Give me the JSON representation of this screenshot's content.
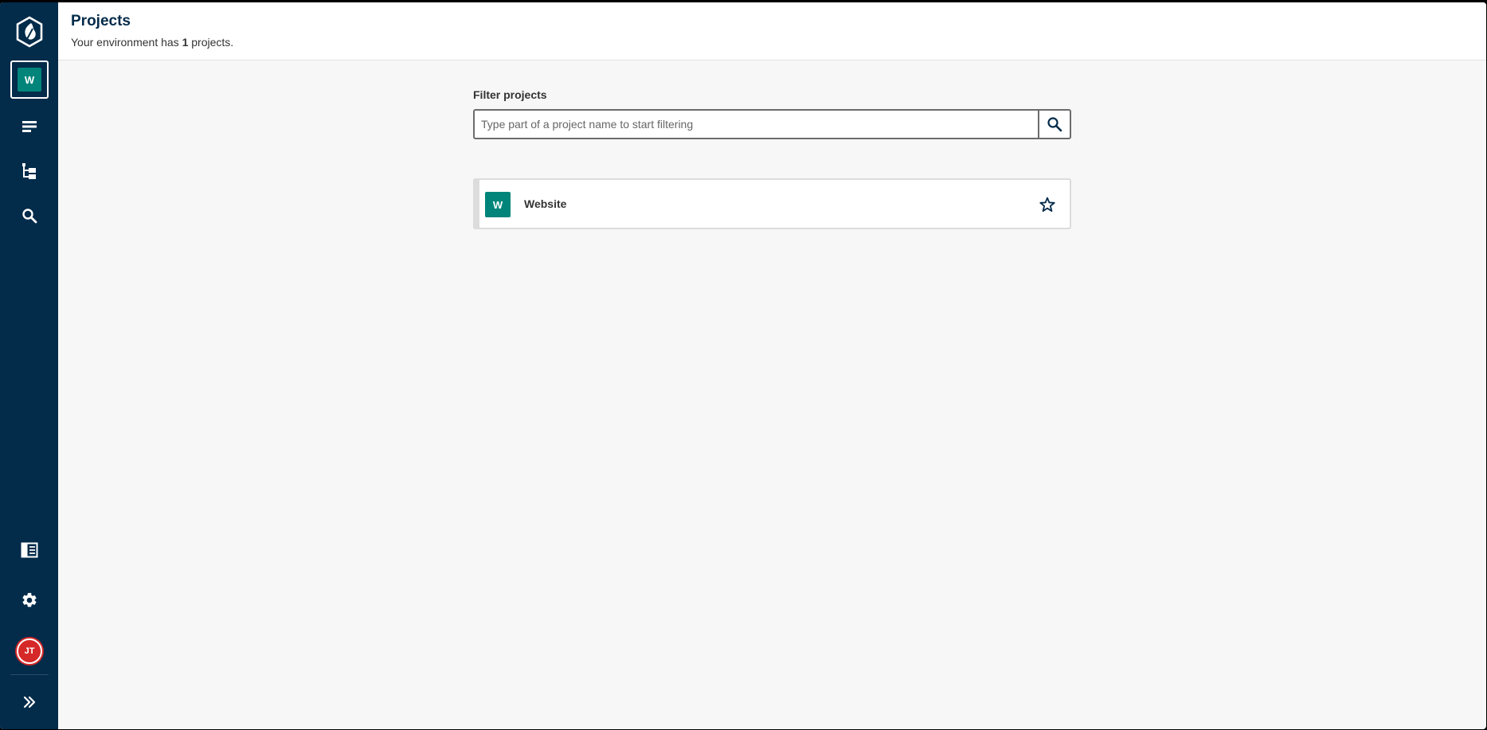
{
  "header": {
    "title": "Projects",
    "subtitle_prefix": "Your environment has ",
    "project_count": "1",
    "subtitle_suffix": " projects."
  },
  "sidebar": {
    "current_project_initial": "W",
    "user_initials": "JT",
    "icons": [
      "logo-icon",
      "list-icon",
      "tree-icon",
      "search-icon",
      "docs-icon",
      "gear-icon",
      "expand-icon"
    ]
  },
  "filter": {
    "label": "Filter projects",
    "placeholder": "Type part of a project name to start filtering"
  },
  "projects": [
    {
      "initial": "W",
      "name": "Website",
      "starred": false
    }
  ],
  "colors": {
    "sidebar": "#032b4a",
    "project_avatar": "#01857a",
    "user_avatar": "#d62828",
    "title": "#032b4a"
  }
}
